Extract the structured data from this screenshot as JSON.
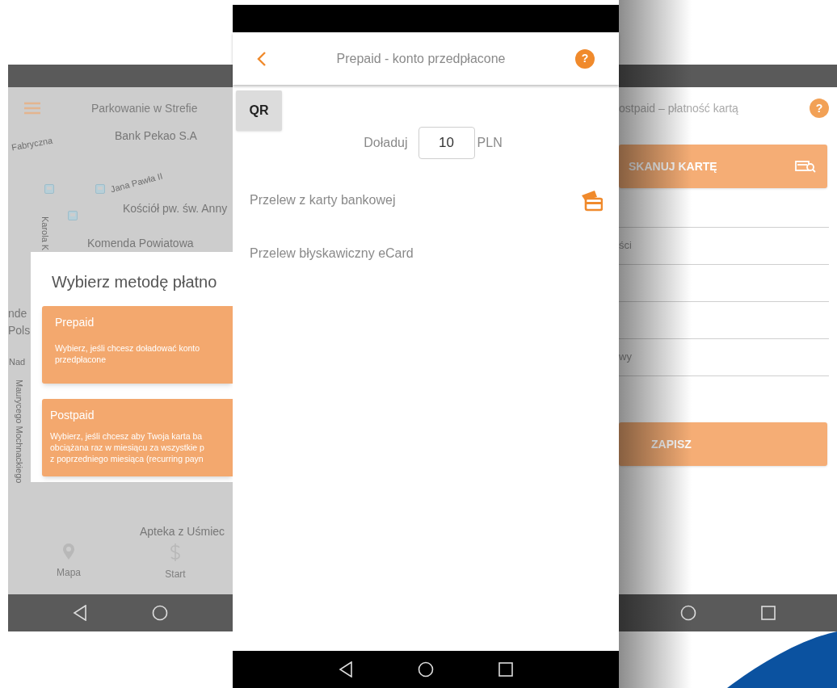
{
  "left_screen": {
    "header_title": "Parkowanie w Strefie",
    "map_labels": [
      {
        "text": "Bank Pekao S.A",
        "kind": "place"
      },
      {
        "text": "Fabryczna",
        "kind": "street"
      },
      {
        "text": "Jana Pawła II",
        "kind": "street"
      },
      {
        "text": "Kościół pw. św. Anny",
        "kind": "place"
      },
      {
        "text": "Karola K",
        "kind": "street_vertical"
      },
      {
        "text": "Komenda Powiatowa",
        "kind": "place"
      },
      {
        "text": "nde",
        "kind": "place"
      },
      {
        "text": "Pols",
        "kind": "place"
      },
      {
        "text": "Nad",
        "kind": "street"
      },
      {
        "text": "Maurycego Mochnackiego",
        "kind": "street_vertical"
      },
      {
        "text": "Apteka z Uśmiec",
        "kind": "place"
      }
    ],
    "dialog": {
      "title": "Wybierz metodę płatno",
      "options": [
        {
          "title": "Prepaid",
          "description": [
            "Wybierz, jeśli chcesz doładować konto",
            "przedpłacone"
          ]
        },
        {
          "title": "Postpaid",
          "description": [
            "Wybierz, jeśli chcesz aby Twoja karta ba",
            "obciążana raz w miesiącu za wszystkie p",
            "z poprzedniego miesiąca (recurring payn"
          ]
        }
      ]
    },
    "bottom_nav": [
      {
        "label": "Mapa",
        "kind": "map"
      },
      {
        "label": "Start",
        "kind": "payment"
      }
    ]
  },
  "center_screen": {
    "header": {
      "title": "Prepaid - konto przedpłacone",
      "help": "?"
    },
    "qr_button": "QR",
    "top_up": {
      "label": "Doładuj",
      "value": "10",
      "currency": "PLN"
    },
    "methods": [
      {
        "label": "Przelew z karty bankowej",
        "has_icon": true
      },
      {
        "label": "Przelew błyskawiczny eCard",
        "has_icon": false
      }
    ]
  },
  "right_screen": {
    "header_title": "ostpaid – płatność kartą",
    "help": "?",
    "scan_button": "SKANUJ KARTĘ",
    "fields": [
      {
        "kind": "blank"
      },
      {
        "kind": "labeled",
        "label": "ści"
      },
      {
        "kind": "blank"
      },
      {
        "kind": "blank"
      },
      {
        "kind": "labeled",
        "label": "wy"
      }
    ],
    "save_button": "ZAPISZ"
  }
}
